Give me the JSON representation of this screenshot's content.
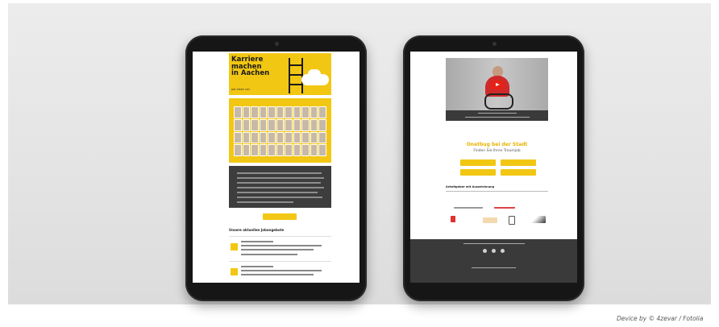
{
  "colors": {
    "accent": "#f2c713",
    "dark": "#3d3d3d",
    "red": "#e62117"
  },
  "left_tablet": {
    "hero": {
      "title_lines": [
        "Karriere",
        "machen",
        "in Aachen"
      ],
      "subtitle": "Job Ideen bei"
    },
    "section_title": "Unsere aktuellen Jobangebote"
  },
  "right_tablet": {
    "video": {
      "icon": "play-icon"
    },
    "headline": "Onetbug bei der Stadt",
    "subline": "Finden Sie Ihren Traumjob",
    "logos_title": "Arbeitgeber mit Auszeichnung"
  },
  "credit": "Device by © 4zevar / Fotolia"
}
